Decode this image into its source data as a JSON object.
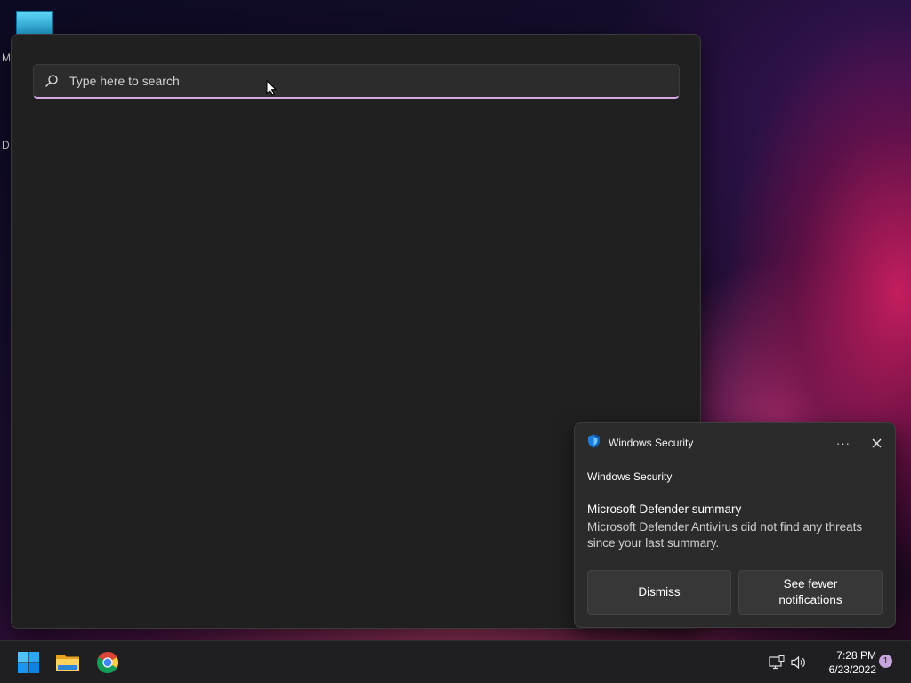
{
  "desktop": {
    "partial_label_1": "M",
    "partial_label_2": "D"
  },
  "search": {
    "placeholder": "Type here to search",
    "value": ""
  },
  "toast": {
    "app_name": "Windows Security",
    "more_label": "···",
    "attribution": "Windows Security",
    "title": "Microsoft Defender summary",
    "body": "Microsoft Defender Antivirus did not find any threats since your last summary.",
    "dismiss_label": "Dismiss",
    "see_fewer_label": "See fewer notifications"
  },
  "taskbar": {
    "icons": [
      "windows-start-icon",
      "file-explorer-icon",
      "chrome-icon"
    ],
    "tray_icons": [
      "network-icon",
      "volume-icon"
    ],
    "time": "7:28 PM",
    "date": "6/23/2022",
    "notification_count": "1"
  },
  "colors": {
    "accent": "#d7a6e6",
    "panel_bg": "#202020",
    "toast_bg": "#2b2b2b",
    "taskbar_bg": "#1f1f22",
    "windows_blue": "#0a84e0"
  }
}
